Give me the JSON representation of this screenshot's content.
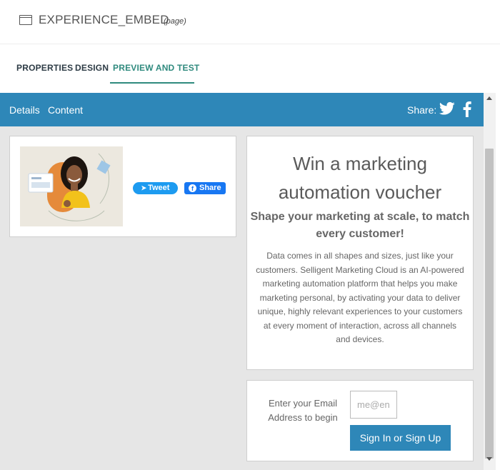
{
  "page": {
    "title": "EXPERIENCE_EMBED",
    "kind": "(page)"
  },
  "tabs": [
    {
      "label": "PROPERTIES"
    },
    {
      "label": "DESIGN"
    },
    {
      "label": "PREVIEW AND TEST",
      "active": true
    }
  ],
  "preview": {
    "topbar": {
      "links": [
        "Details",
        "Content"
      ],
      "share_label": "Share:",
      "share_icons": [
        "twitter-icon",
        "facebook-icon"
      ],
      "color": "#2e87b8"
    },
    "social": {
      "tweet_label": "Tweet",
      "share_label": "Share"
    },
    "promo": {
      "title": "Win a marketing automation voucher",
      "subtitle": "Shape your marketing at scale, to match every customer!",
      "body": "Data comes in all shapes and sizes, just like your customers. Selligent Marketing Cloud is an AI-powered marketing automation platform that helps you make marketing personal, by activating your data to deliver unique, highly relevant experiences to your customers at every moment of interaction, across all channels and devices."
    },
    "signup": {
      "label": "Enter your Email Address to begin",
      "email_placeholder": "me@en",
      "button_label": "Sign In or Sign Up"
    }
  },
  "colors": {
    "accent": "#2f8a7e",
    "bar": "#2e87b8"
  }
}
